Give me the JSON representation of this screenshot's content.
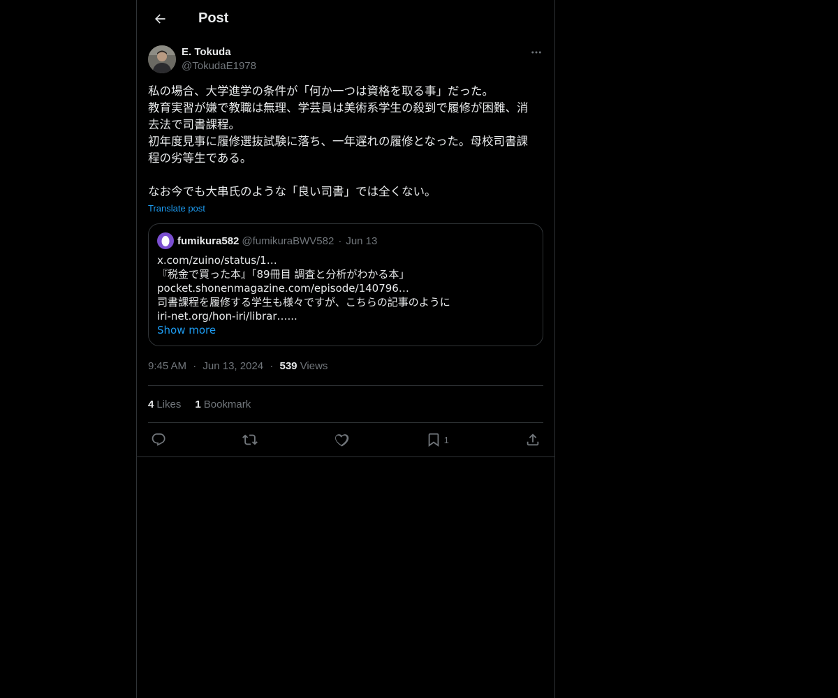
{
  "header": {
    "title": "Post"
  },
  "author": {
    "name": "E. Tokuda",
    "handle": "@TokudaE1978"
  },
  "post": {
    "lines": [
      "私の場合、大学進学の条件が「何か一つは資格を取る事」だった。",
      "教育実習が嫌で教職は無理、学芸員は美術系学生の殺到で履修が困難、消",
      "去法で司書課程。",
      "初年度見事に履修選抜試験に落ち、一年遅れの履修となった。母校司書課",
      "程の劣等生である。",
      "",
      "なお今でも大串氏のような「良い司書」では全くない。"
    ],
    "translate_label": "Translate post"
  },
  "quote": {
    "name": "fumikura582",
    "handle": "@fumikuraBWV582",
    "dot": "·",
    "date": "Jun 13",
    "lines": [
      "x.com/zuino/status/1…",
      "『税金で買った本』「89冊目 調査と分析がわかる本」",
      "pocket.shonenmagazine.com/episode/140796…",
      "司書課程を履修する学生も様々ですが、こちらの記事のように",
      "iri-net.org/hon-iri/librar…..."
    ],
    "show_more": "Show more"
  },
  "meta": {
    "time": "9:45 AM",
    "dot1": "·",
    "date": "Jun 13, 2024",
    "dot2": "·",
    "views_count": "539",
    "views_label": "Views"
  },
  "stats": {
    "likes_count": "4",
    "likes_label": "Likes",
    "bookmarks_count": "1",
    "bookmarks_label": "Bookmark"
  },
  "actions": {
    "bookmark_count": "1",
    "icons": [
      "reply-icon",
      "repost-icon",
      "like-icon",
      "bookmark-icon",
      "share-icon"
    ]
  },
  "colors": {
    "background": "#000000",
    "text": "#e7e9ea",
    "muted": "#71767b",
    "accent": "#1d9bf0",
    "border": "#2f3336"
  }
}
